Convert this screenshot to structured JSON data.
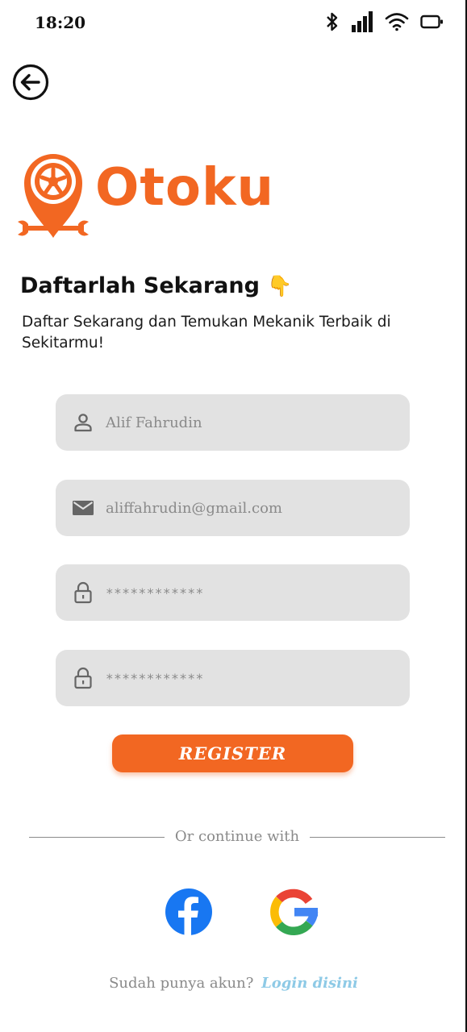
{
  "status_bar": {
    "time": "18:20",
    "icons": [
      "bluetooth-icon",
      "signal-icon",
      "wifi-icon",
      "battery-icon"
    ]
  },
  "navigation": {
    "back_icon": "arrow-left-circle-icon"
  },
  "brand": {
    "name": "Otoku",
    "color": "#f26722"
  },
  "heading": {
    "title": "Daftarlah Sekarang",
    "title_emoji": "👇",
    "subtitle": "Daftar Sekarang dan Temukan Mekanik Terbaik di Sekitarmu!"
  },
  "form": {
    "name": {
      "value": "Alif Fahrudin",
      "icon": "person-icon"
    },
    "email": {
      "value": "aliffahrudin@gmail.com",
      "icon": "mail-icon"
    },
    "password": {
      "value": "************",
      "icon": "lock-icon"
    },
    "confirm_password": {
      "value": "************",
      "icon": "lock-icon"
    },
    "submit_label": "REGISTER"
  },
  "social": {
    "divider_text": "Or continue with",
    "providers": [
      {
        "name": "facebook-icon",
        "color": "#1877f2"
      },
      {
        "name": "google-icon",
        "colors": [
          "#ea4335",
          "#fbbc05",
          "#34a853",
          "#4285f4"
        ]
      }
    ]
  },
  "footer": {
    "prompt": "Sudah punya akun?",
    "link": "Login disini",
    "link_color": "#8ecae6"
  },
  "colors": {
    "accent": "#f26722",
    "field_bg": "#e2e2e2",
    "muted_text": "#8a8a8a"
  }
}
